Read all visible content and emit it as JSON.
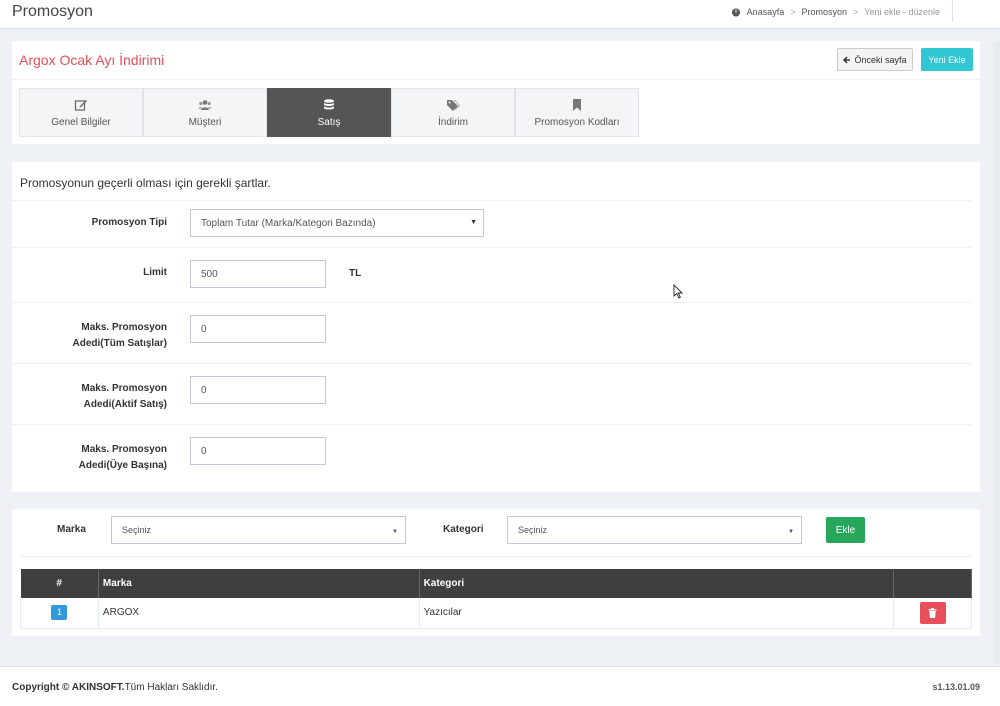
{
  "header": {
    "page_title": "Promosyon",
    "breadcrumb": [
      "Anasayfa",
      "Promosyon",
      "Yeni ekle - düzenle"
    ],
    "breadcrumb_sep": ">"
  },
  "promo": {
    "title": "Argox Ocak Ayı İndirimi",
    "back_label": "Önceki sayfa",
    "new_label": "Yeni Ekle"
  },
  "tabs": [
    {
      "label": "Genel Bilgiler",
      "icon": "edit-icon"
    },
    {
      "label": "Müşteri",
      "icon": "users-icon"
    },
    {
      "label": "Satış",
      "icon": "database-icon",
      "active": true
    },
    {
      "label": "İndirim",
      "icon": "tags-icon"
    },
    {
      "label": "Promosyon Kodları",
      "icon": "bookmark-icon"
    }
  ],
  "conditions": {
    "title": "Promosyonun geçerli olması için gerekli şartlar.",
    "promo_type_label": "Promosyon Tipi",
    "promo_type_value": "Toplam Tutar (Marka/Kategori Bazında)",
    "limit_label": "Limit",
    "limit_value": "500",
    "limit_unit": "TL",
    "max_all_label_1": "Maks. Promosyon",
    "max_all_label_2": "Adedi(Tüm Satışlar)",
    "max_all_value": "0",
    "max_active_label_1": "Maks. Promosyon",
    "max_active_label_2": "Adedi(Aktif Satış)",
    "max_active_value": "0",
    "max_member_label_1": "Maks. Promosyon",
    "max_member_label_2": "Adedi(Üye Başına)",
    "max_member_value": "0"
  },
  "filter": {
    "brand_label": "Marka",
    "brand_value": "Seçiniz",
    "category_label": "Kategori",
    "category_value": "Seçiniz",
    "add_label": "Ekle"
  },
  "table": {
    "headers": [
      "#",
      "Marka",
      "Kategori",
      ""
    ],
    "rows": [
      {
        "num": "1",
        "brand": "ARGOX",
        "category": "Yazıcılar"
      }
    ]
  },
  "footer": {
    "copyright_prefix": "Copyright © ",
    "company": "AKINSOFT.",
    "rights": "Tüm Hakları Saklıdır.",
    "version": "s1.13.01.09"
  },
  "colors": {
    "accent_red": "#e7505a",
    "new_button": "#32c5d2",
    "add_button": "#26a65b",
    "active_tab": "#555555",
    "badge": "#3598dc"
  }
}
